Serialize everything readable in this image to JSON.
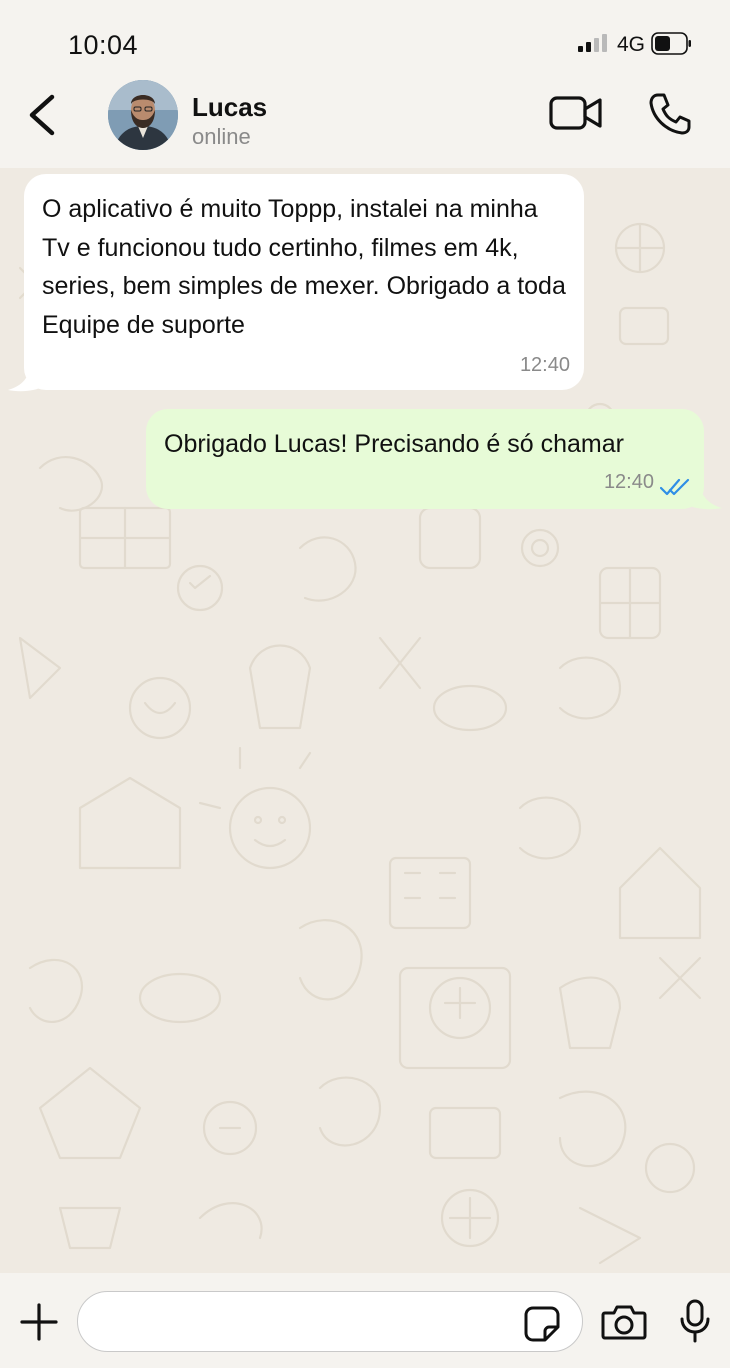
{
  "status_bar": {
    "time": "10:04",
    "network": "4G",
    "signal_bars_filled": 2,
    "signal_bars_total": 4,
    "battery_level": 0.5
  },
  "header": {
    "back_icon": "chevron-left-icon",
    "contact_name": "Lucas",
    "contact_status": "online",
    "video_icon": "video-camera-icon",
    "call_icon": "phone-icon"
  },
  "messages": [
    {
      "direction": "incoming",
      "text": "O aplicativo é muito Toppp, instalei na minha Tv e funcionou tudo certinho, filmes em 4k, series, bem simples de mexer. Obrigado a toda Equipe de suporte",
      "time": "12:40"
    },
    {
      "direction": "outgoing",
      "text": "Obrigado Lucas! Precisando é só chamar",
      "time": "12:40",
      "status": "read"
    }
  ],
  "input_bar": {
    "message_value": "",
    "message_placeholder": ""
  },
  "colors": {
    "incoming_bubble": "#ffffff",
    "outgoing_bubble": "#e7fbd7",
    "chat_background": "#efeae2",
    "read_tick": "#2f8ee6",
    "bar_background": "#f5f3ef"
  }
}
